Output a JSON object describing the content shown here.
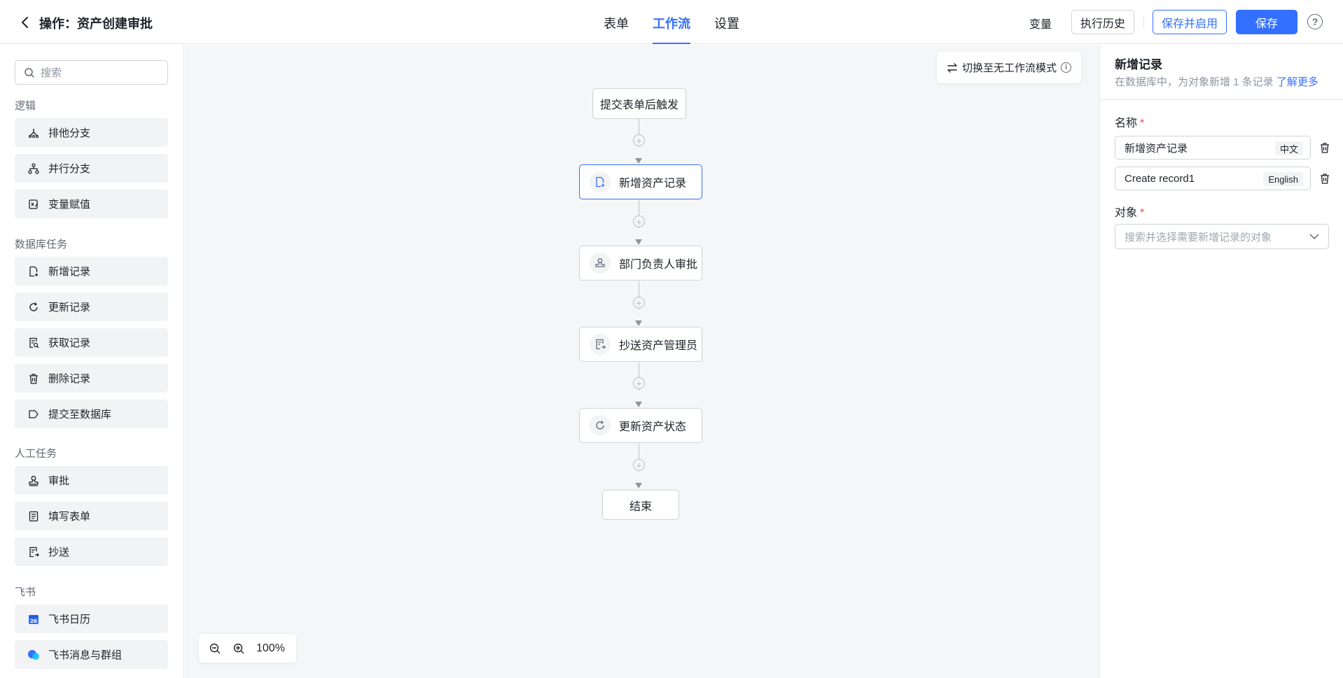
{
  "header": {
    "title": "操作：资产创建审批",
    "tabs": [
      {
        "label": "表单",
        "active": false
      },
      {
        "label": "工作流",
        "active": true
      },
      {
        "label": "设置",
        "active": false
      }
    ],
    "variables_label": "变量",
    "history_label": "执行历史",
    "save_enable_label": "保存并启用",
    "save_label": "保存",
    "help_symbol": "?"
  },
  "sidebar": {
    "search_placeholder": "搜索",
    "groups": [
      {
        "title": "逻辑",
        "items": [
          {
            "label": "排他分支",
            "icon": "exclusive-branch-icon"
          },
          {
            "label": "并行分支",
            "icon": "parallel-branch-icon"
          },
          {
            "label": "变量赋值",
            "icon": "variable-assign-icon"
          }
        ]
      },
      {
        "title": "数据库任务",
        "items": [
          {
            "label": "新增记录",
            "icon": "add-record-icon"
          },
          {
            "label": "更新记录",
            "icon": "update-record-icon"
          },
          {
            "label": "获取记录",
            "icon": "get-record-icon"
          },
          {
            "label": "删除记录",
            "icon": "delete-record-icon"
          },
          {
            "label": "提交至数据库",
            "icon": "commit-icon"
          }
        ]
      },
      {
        "title": "人工任务",
        "items": [
          {
            "label": "审批",
            "icon": "approval-icon"
          },
          {
            "label": "填写表单",
            "icon": "fill-form-icon"
          },
          {
            "label": "抄送",
            "icon": "cc-icon"
          }
        ]
      },
      {
        "title": "飞书",
        "items": [
          {
            "label": "飞书日历",
            "icon": "calendar-icon",
            "calendar_day": "26"
          },
          {
            "label": "飞书消息与群组",
            "icon": "message-icon"
          }
        ]
      }
    ]
  },
  "canvas": {
    "mode_switch_label": "切换至无工作流模式",
    "nodes": [
      {
        "label": "提交表单后触发",
        "kind": "trigger"
      },
      {
        "label": "新增资产记录",
        "kind": "add-record",
        "selected": true
      },
      {
        "label": "部门负责人审批",
        "kind": "approval"
      },
      {
        "label": "抄送资产管理员",
        "kind": "cc"
      },
      {
        "label": "更新资产状态",
        "kind": "update"
      },
      {
        "label": "结束",
        "kind": "end"
      }
    ],
    "zoom_level": "100%"
  },
  "panel": {
    "title": "新增记录",
    "subtitle": "在数据库中，为对象新增 1 条记录",
    "learn_more": "了解更多",
    "name_label": "名称",
    "name_zh_value": "新增资产记录",
    "name_zh_lang": "中文",
    "name_en_value": "Create record1",
    "name_en_lang": "English",
    "object_label": "对象",
    "required_mark": "*",
    "object_placeholder": "搜索并选择需要新增记录的对象"
  },
  "colors": {
    "accent": "#3370ff",
    "danger": "#f54a45",
    "canvas_bg": "#f5f6f7",
    "item_bg": "#f2f3f5"
  }
}
